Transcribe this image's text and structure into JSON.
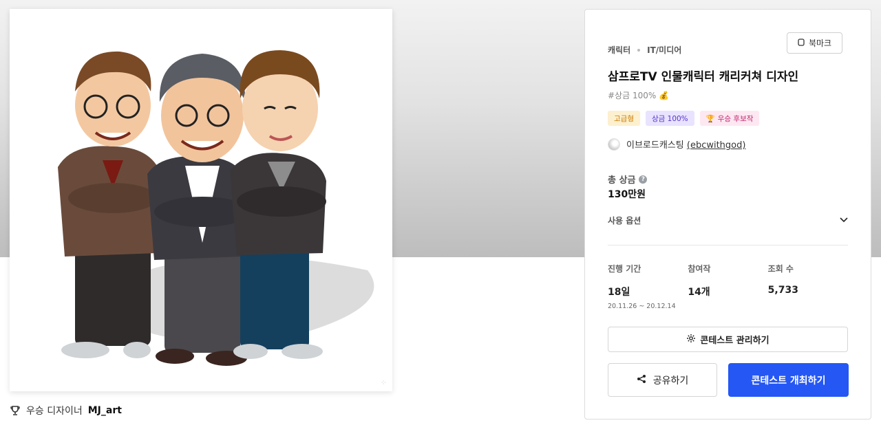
{
  "artwork": {
    "watermark": "⁘"
  },
  "winner": {
    "prefix": "우승 디자이너",
    "name": "MJ_art"
  },
  "panel": {
    "category": "캐릭터",
    "subcategory": "IT/미디어",
    "bookmark_label": "북마크",
    "title": "삼프로TV 인물캐릭터 캐리커쳐 디자인",
    "subtitle": "#상금 100%",
    "subtitle_emoji": "💰",
    "badges": {
      "premium": "고급형",
      "prize": "상금 100%",
      "candidate": "우승 후보작",
      "candidate_icon": "🏆"
    },
    "host": {
      "name": "이브로드캐스팅",
      "handle": "(ebcwithgod)"
    },
    "total_prize_label": "총 상금",
    "total_prize_help": "?",
    "total_prize_value": "130만원",
    "usage_option_label": "사용 옵션",
    "stats": {
      "period_label": "진행 기간",
      "period_value": "18일",
      "period_range": "20.11.26 ~ 20.12.14",
      "entries_label": "참여작",
      "entries_value": "14개",
      "views_label": "조회 수",
      "views_value": "5,733"
    },
    "manage_label": "콘테스트 관리하기",
    "share_label": "공유하기",
    "host_contest_label": "콘테스트 개최하기"
  },
  "colors": {
    "primary": "#2557f5",
    "premium_bg": "#fdf0cf",
    "prize_bg": "#e9e3ff",
    "candidate_bg": "#fde8f2"
  }
}
